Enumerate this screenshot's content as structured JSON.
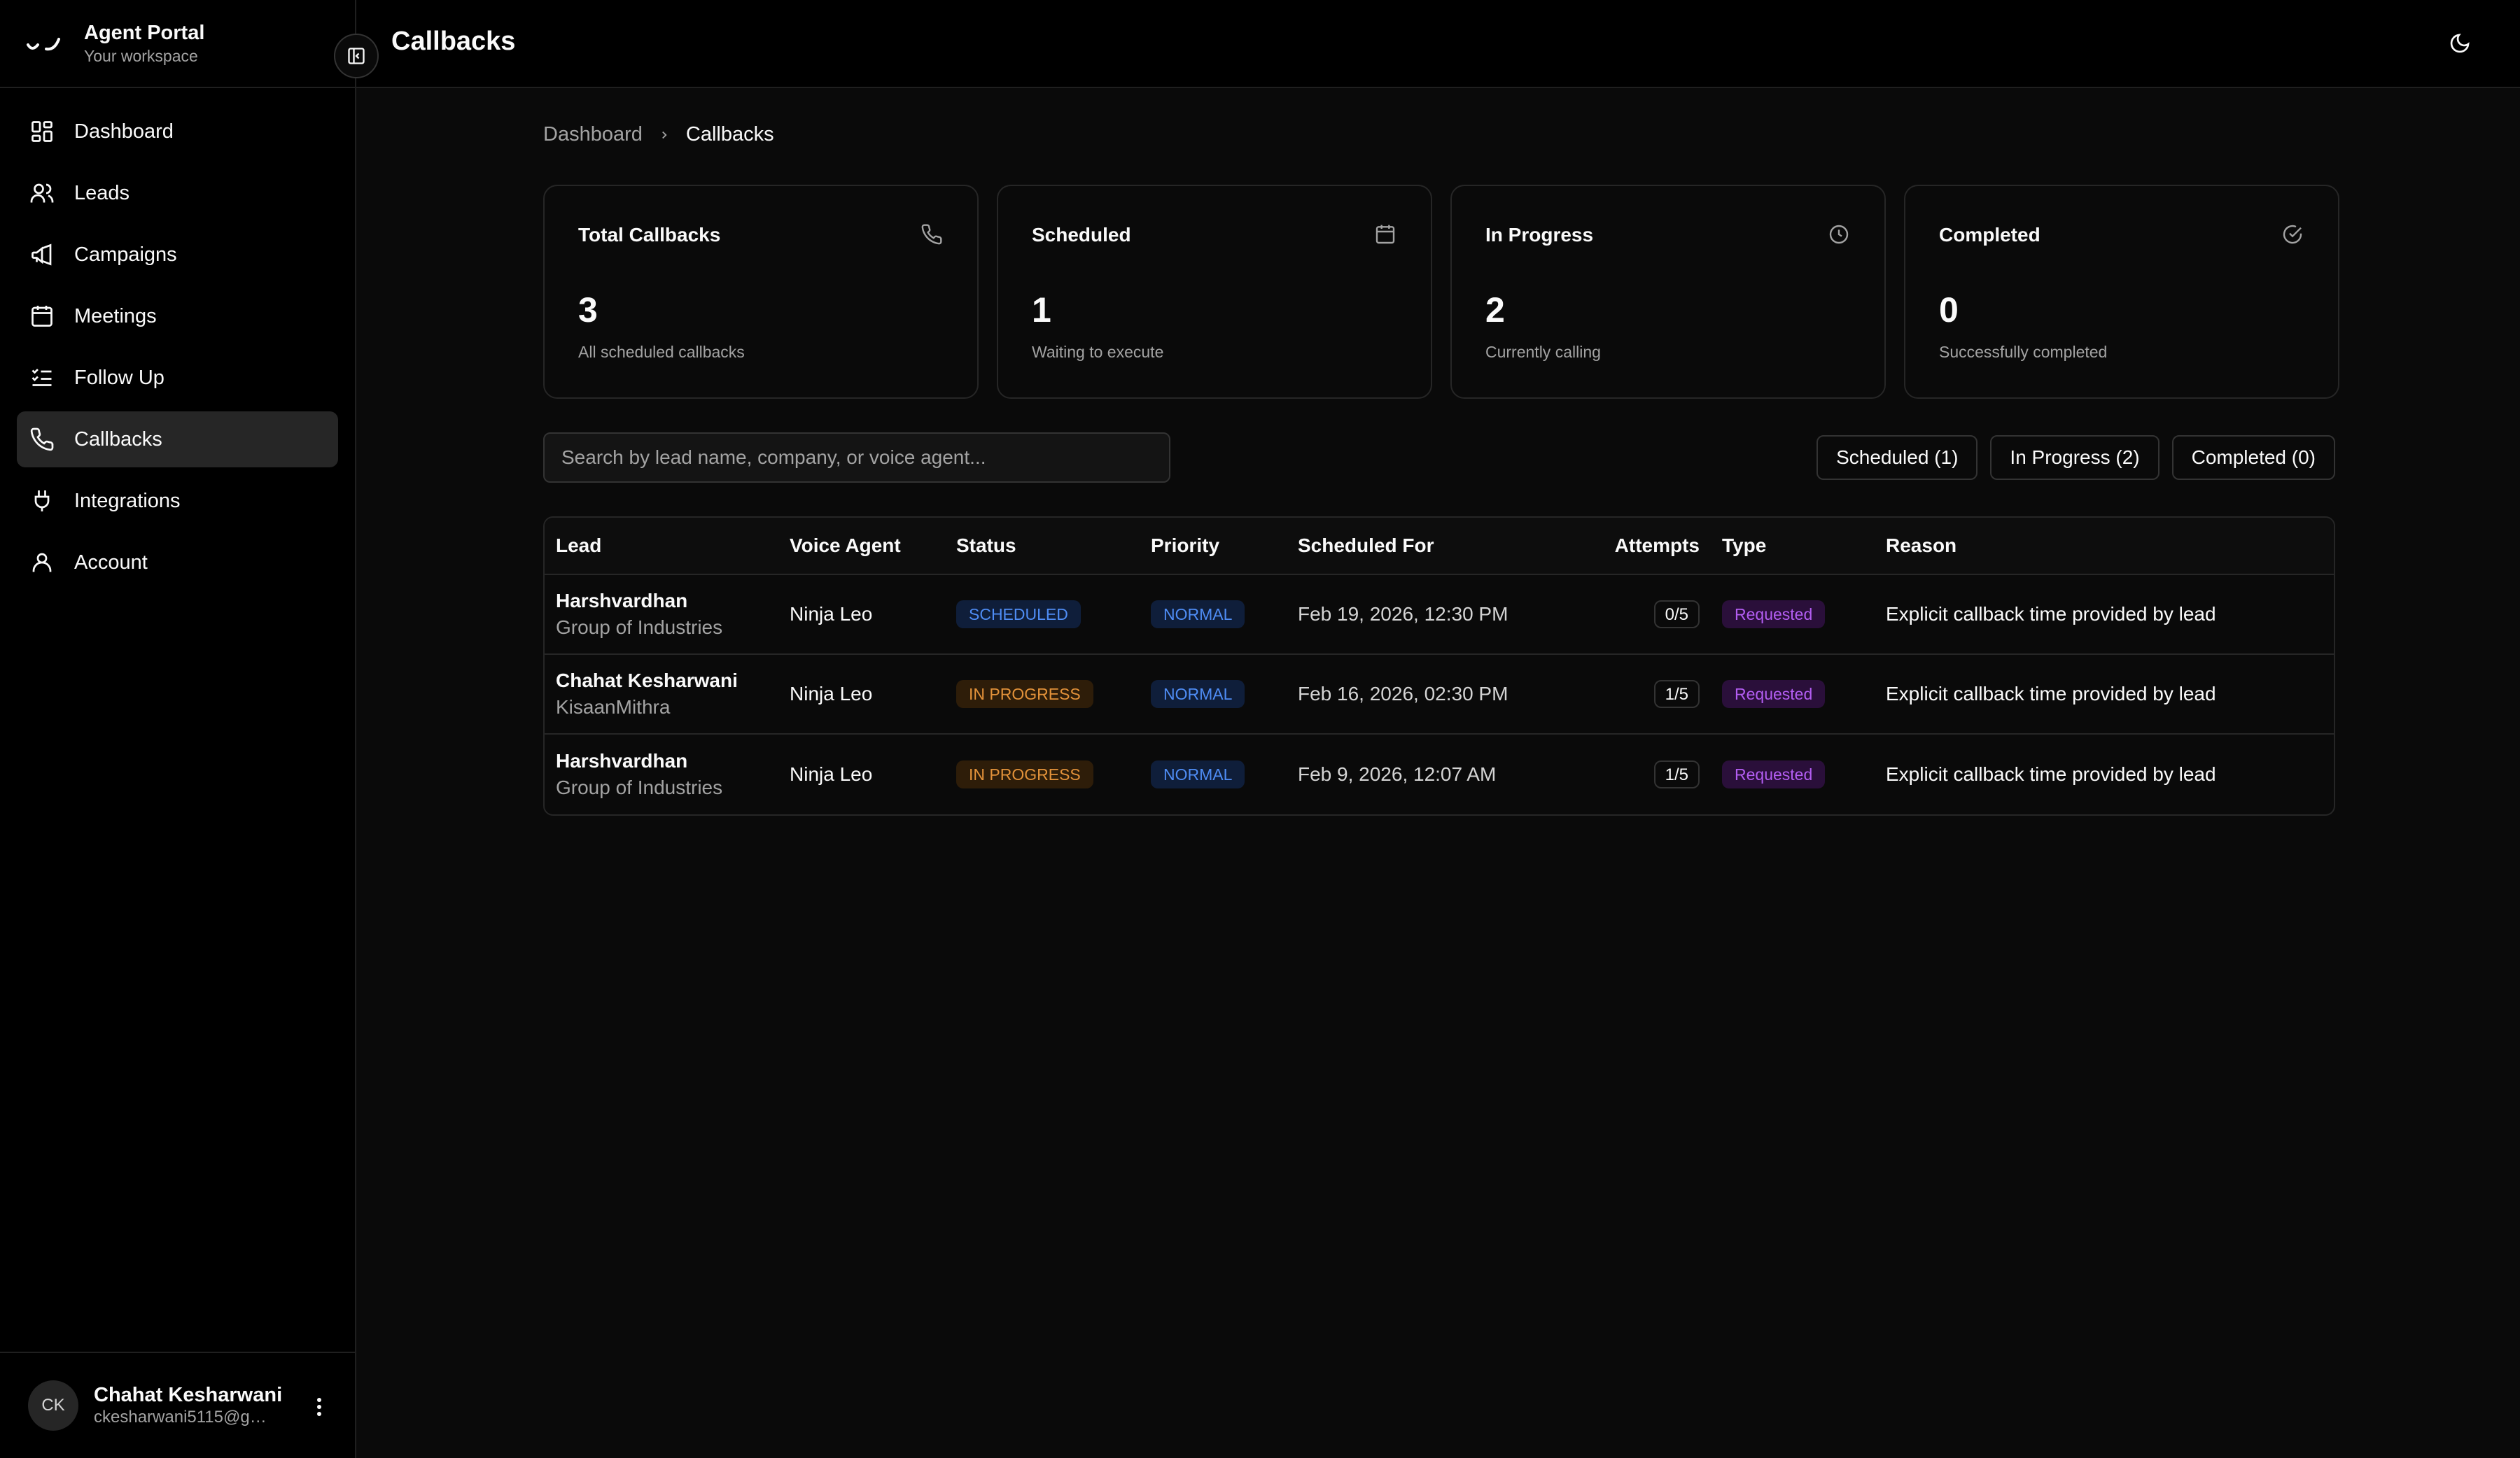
{
  "app": {
    "name": "Agent Portal",
    "workspace": "Your workspace"
  },
  "sidebar": {
    "items": [
      {
        "label": "Dashboard",
        "icon": "dashboard-icon"
      },
      {
        "label": "Leads",
        "icon": "users-icon"
      },
      {
        "label": "Campaigns",
        "icon": "megaphone-icon"
      },
      {
        "label": "Meetings",
        "icon": "calendar-icon"
      },
      {
        "label": "Follow Up",
        "icon": "list-checks-icon"
      },
      {
        "label": "Callbacks",
        "icon": "phone-icon",
        "active": true
      },
      {
        "label": "Integrations",
        "icon": "plug-icon"
      },
      {
        "label": "Account",
        "icon": "user-icon"
      }
    ]
  },
  "user": {
    "initials": "CK",
    "name": "Chahat Kesharwani",
    "email": "ckesharwani5115@gm..."
  },
  "header": {
    "title": "Callbacks"
  },
  "breadcrumb": {
    "items": [
      "Dashboard",
      "Callbacks"
    ]
  },
  "stats": [
    {
      "title": "Total Callbacks",
      "value": "3",
      "sub": "All scheduled callbacks",
      "icon": "phone-icon"
    },
    {
      "title": "Scheduled",
      "value": "1",
      "sub": "Waiting to execute",
      "icon": "calendar-icon"
    },
    {
      "title": "In Progress",
      "value": "2",
      "sub": "Currently calling",
      "icon": "clock-icon"
    },
    {
      "title": "Completed",
      "value": "0",
      "sub": "Successfully completed",
      "icon": "check-circle-icon"
    }
  ],
  "search": {
    "placeholder": "Search by lead name, company, or voice agent..."
  },
  "filters": [
    "Scheduled (1)",
    "In Progress (2)",
    "Completed (0)"
  ],
  "table": {
    "headers": [
      "Lead",
      "Voice Agent",
      "Status",
      "Priority",
      "Scheduled For",
      "Attempts",
      "Type",
      "Reason"
    ],
    "rows": [
      {
        "lead": "Harshvardhan",
        "company": "Group of Industries",
        "agent": "Ninja Leo",
        "status": "SCHEDULED",
        "priority": "NORMAL",
        "scheduled": "Feb 19, 2026, 12:30 PM",
        "attempts": "0/5",
        "type": "Requested",
        "reason": "Explicit callback time provided by lead"
      },
      {
        "lead": "Chahat Kesharwani",
        "company": "KisaanMithra",
        "agent": "Ninja Leo",
        "status": "IN PROGRESS",
        "priority": "NORMAL",
        "scheduled": "Feb 16, 2026, 02:30 PM",
        "attempts": "1/5",
        "type": "Requested",
        "reason": "Explicit callback time provided by lead"
      },
      {
        "lead": "Harshvardhan",
        "company": "Group of Industries",
        "agent": "Ninja Leo",
        "status": "IN PROGRESS",
        "priority": "NORMAL",
        "scheduled": "Feb 9, 2026, 12:07 AM",
        "attempts": "1/5",
        "type": "Requested",
        "reason": "Explicit callback time provided by lead"
      }
    ]
  },
  "colors": {
    "background": "#0a0a0a",
    "sidebar": "#000000",
    "active_nav": "#262626",
    "badge_blue": "#4f8df5",
    "badge_orange": "#e3923a",
    "badge_purple": "#b35df2"
  }
}
